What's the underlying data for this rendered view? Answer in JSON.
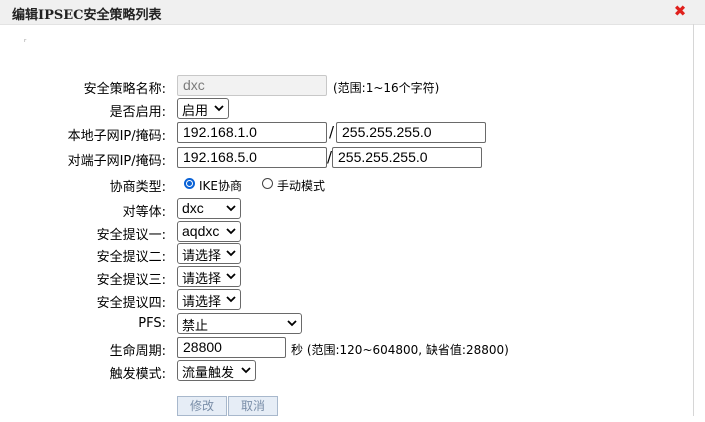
{
  "dialog": {
    "title": "编辑IPSEC安全策略列表",
    "close_glyph": "✖",
    "close_color": "#e0201c"
  },
  "form": {
    "policy_name": {
      "label": "安全策略名称:",
      "value": "dxc",
      "hint": "(范围:1~16个字符)"
    },
    "enabled": {
      "label": "是否启用:",
      "value": "启用"
    },
    "local_subnet": {
      "label": "本地子网IP/掩码:",
      "ip": "192.168.1.0",
      "separator": "/",
      "mask": "255.255.255.0"
    },
    "remote_subnet": {
      "label": "对端子网IP/掩码:",
      "ip": "192.168.5.0",
      "separator": "/",
      "mask": "255.255.255.0"
    },
    "negotiation": {
      "label": "协商类型:",
      "options": [
        "IKE协商",
        "手动模式"
      ],
      "selected": "IKE协商"
    },
    "peer": {
      "label": "对等体:",
      "value": "dxc"
    },
    "proposal1": {
      "label": "安全提议一:",
      "value": "aqdxc"
    },
    "proposal2": {
      "label": "安全提议二:",
      "value": "请选择"
    },
    "proposal3": {
      "label": "安全提议三:",
      "value": "请选择"
    },
    "proposal4": {
      "label": "安全提议四:",
      "value": "请选择"
    },
    "pfs": {
      "label": "PFS:",
      "value": "禁止"
    },
    "lifetime": {
      "label": "生命周期:",
      "value": "28800",
      "unit_hint": "秒 (范围:120~604800, 缺省值:28800)"
    },
    "trigger": {
      "label": "触发模式:",
      "value": "流量触发"
    }
  },
  "buttons": {
    "modify": "修改",
    "cancel": "取消"
  },
  "colors": {
    "accent": "#0a62d6",
    "button_text": "#7a8ea8",
    "button_bg": "#e6edf6"
  }
}
